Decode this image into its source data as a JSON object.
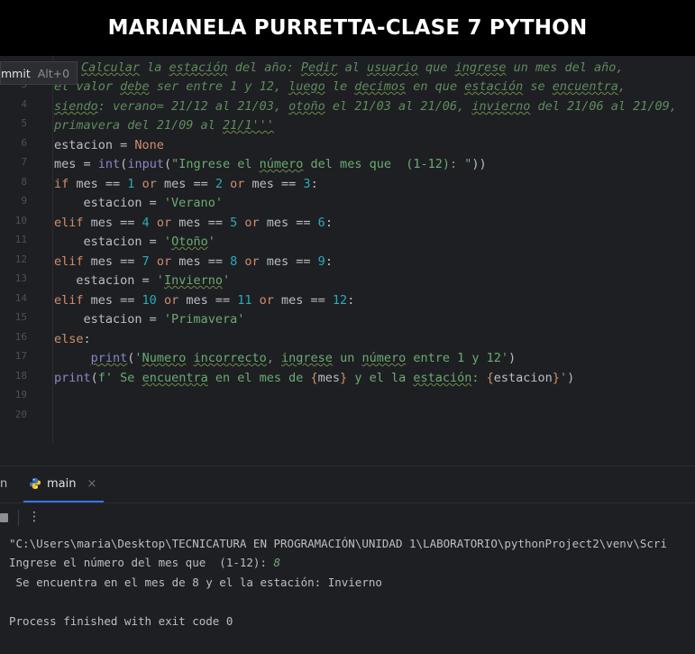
{
  "title": "MARIANELA PURRETTA-CLASE 7 PYTHON",
  "commit_popup": {
    "label": "mmit",
    "shortcut": "Alt+0"
  },
  "gutter_lines": [
    "",
    "3",
    "4",
    "5",
    "6",
    "7",
    "8",
    "9",
    "10",
    "11",
    "12",
    "13",
    "14",
    "15",
    "16",
    "17",
    "18",
    "19",
    "20"
  ],
  "code": {
    "l1": {
      "p1": "Calcular",
      "p2": " la ",
      "p3": "estación",
      "p4": " del año: ",
      "p5": "Pedir",
      "p6": " al ",
      "p7": "usuario",
      "p8": " que ",
      "p9": "ingrese",
      "p10": " un mes del año,"
    },
    "l2": {
      "p1": "el valor ",
      "p2": "debe",
      "p3": " ser entre 1 y 12, ",
      "p4": "luego",
      "p5": " le ",
      "p6": "decimos",
      "p7": " en que ",
      "p8": "estación",
      "p9": " se ",
      "p10": "encuentra",
      "p11": ","
    },
    "l3": {
      "p1": "siendo",
      "p2": ": verano= 21/12 al 21/03, ",
      "p3": "otoño",
      "p4": " el 21/03 al 21/06, ",
      "p5": "invierno",
      "p6": " del 21/06 al 21/09,"
    },
    "l4": {
      "p1": "primavera del 21/09 al ",
      "p2": "21/1'''"
    },
    "l5": {
      "p1": "estacion = ",
      "p2": "None"
    },
    "l6": {
      "p1": "mes = ",
      "p2": "int",
      "p3": "(",
      "p4": "input",
      "p5": "(",
      "p6": "\"Ingrese el ",
      "p7": "número",
      "p8": " del mes que  (1-12): \"",
      "p9": "))"
    },
    "l7": {
      "p1": "if",
      "p2": " mes == ",
      "p3": "1",
      "p4": " or",
      "p5": " mes == ",
      "p6": "2",
      "p7": " or",
      "p8": " mes == ",
      "p9": "3",
      "p10": ":"
    },
    "l8": {
      "p1": "    estacion = ",
      "p2": "'Verano'"
    },
    "l9": {
      "p1": "elif",
      "p2": " mes == ",
      "p3": "4",
      "p4": " or",
      "p5": " mes == ",
      "p6": "5",
      "p7": " or",
      "p8": " mes == ",
      "p9": "6",
      "p10": ":"
    },
    "l10": {
      "p1": "    estacion = ",
      "p2": "'",
      "p3": "Otoño",
      "p4": "'"
    },
    "l11": {
      "p1": "elif",
      "p2": " mes == ",
      "p3": "7",
      "p4": " or",
      "p5": " mes == ",
      "p6": "8",
      "p7": " or",
      "p8": " mes == ",
      "p9": "9",
      "p10": ":"
    },
    "l12": {
      "p1": "   estacion = ",
      "p2": "'",
      "p3": "Invierno",
      "p4": "'"
    },
    "l13": {
      "p1": "elif",
      "p2": " mes == ",
      "p3": "10",
      "p4": " or",
      "p5": " mes == ",
      "p6": "11",
      "p7": " or",
      "p8": " mes == ",
      "p9": "12",
      "p10": ":"
    },
    "l14": {
      "p1": "    estacion = ",
      "p2": "'Primavera'"
    },
    "l15": {
      "p1": "else",
      "p2": ":"
    },
    "l16": {
      "p1": "     ",
      "p2": "print",
      "p3": "(",
      "p4": "'",
      "p5": "Numero",
      "p6": " ",
      "p7": "incorrecto",
      "p8": ", ",
      "p9": "ingrese",
      "p10": " un ",
      "p11": "número",
      "p12": " entre 1 y 12'",
      "p13": ")"
    },
    "l17": {
      "p1": "print",
      "p2": "(",
      "p3": "f' Se ",
      "p4": "encuentra",
      "p5": " en el mes de ",
      "p6": "{",
      "p7": "mes",
      "p8": "}",
      "p9": " y el la ",
      "p10": "estación",
      "p11": ": ",
      "p12": "{",
      "p13": "estacion",
      "p14": "}",
      "p15": "'",
      "p16": ")"
    }
  },
  "run_panel": {
    "tab_stub": "n",
    "tab_label": "main",
    "tab_close": "×",
    "more_icon": "⋮",
    "output": {
      "line1": "\"C:\\Users\\maria\\Desktop\\TECNICATURA EN PROGRAMACIÓN\\UNIDAD 1\\LABORATORIO\\pythonProject2\\venv\\Scri",
      "line2_prompt": "Ingrese el número del mes que  (1-12): ",
      "line2_input": "8",
      "line3": " Se encuentra en el mes de 8 y el la estación: Invierno",
      "line5": "Process finished with exit code 0"
    }
  },
  "colors": {
    "keyword": "#cf8e6d",
    "number": "#2aacb8",
    "string": "#6aab73",
    "comment": "#5f8c5f",
    "tab_accent": "#3574f0"
  }
}
